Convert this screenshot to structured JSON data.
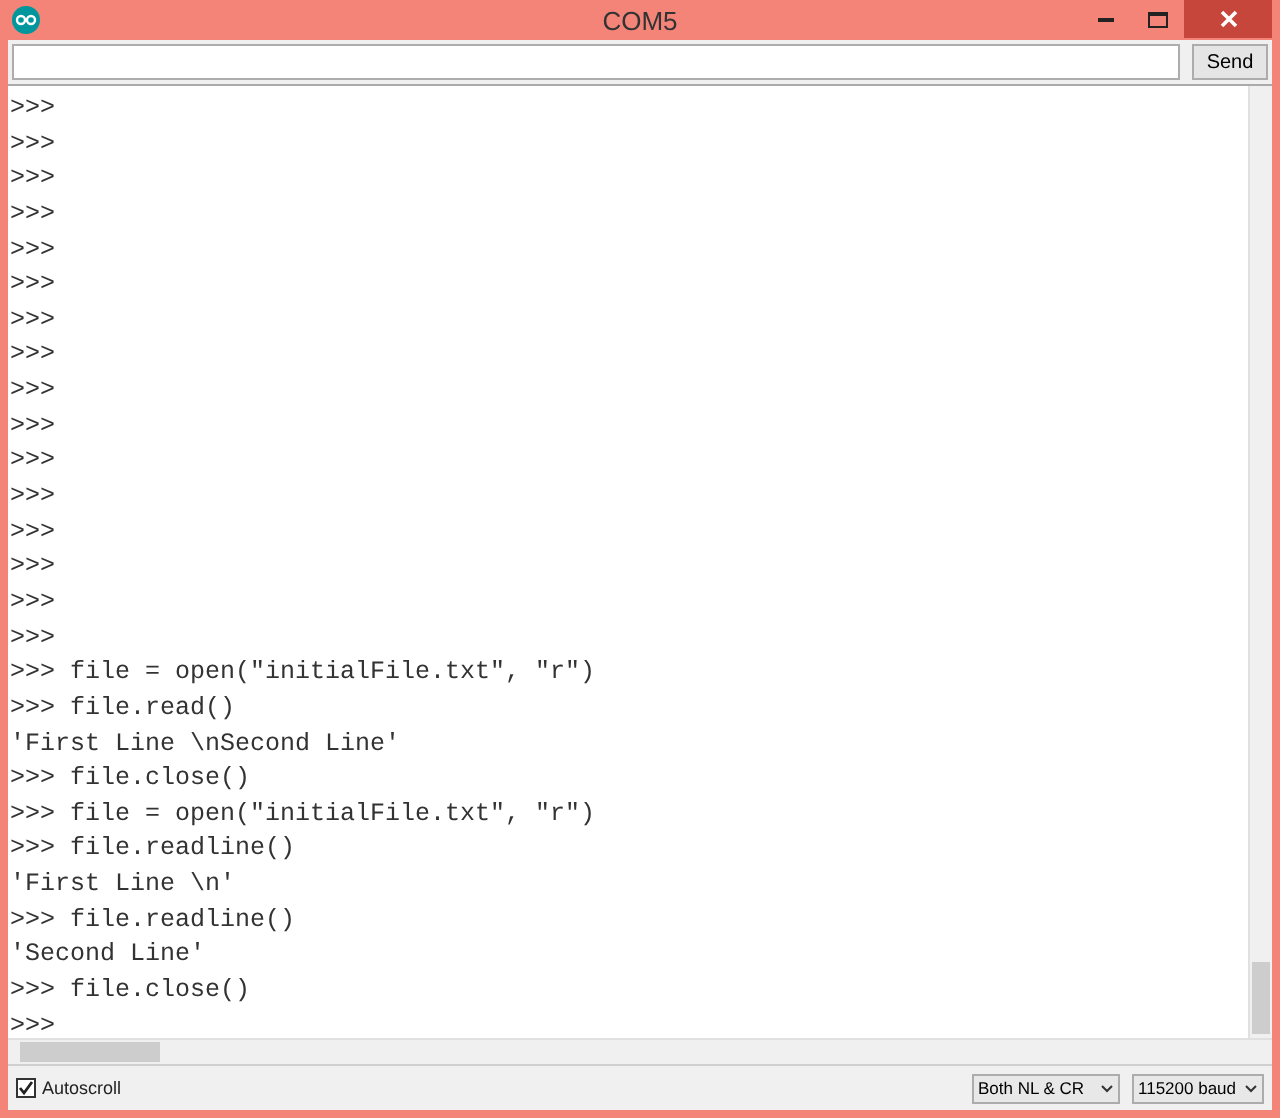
{
  "window": {
    "title": "COM5"
  },
  "send_button": {
    "label": "Send"
  },
  "output_lines": [
    ">>>",
    ">>>",
    ">>>",
    ">>>",
    ">>>",
    ">>>",
    ">>>",
    ">>>",
    ">>>",
    ">>>",
    ">>>",
    ">>>",
    ">>>",
    ">>>",
    ">>>",
    ">>>",
    ">>> file = open(\"initialFile.txt\", \"r\")",
    ">>> file.read()",
    "'First Line \\nSecond Line'",
    ">>> file.close()",
    ">>> file = open(\"initialFile.txt\", \"r\")",
    ">>> file.readline()",
    "'First Line \\n'",
    ">>> file.readline()",
    "'Second Line'",
    ">>> file.close()",
    ">>>"
  ],
  "autoscroll": {
    "label": "Autoscroll",
    "checked": true
  },
  "line_ending": {
    "value": "Both NL & CR"
  },
  "baud_rate": {
    "value": "115200 baud"
  }
}
